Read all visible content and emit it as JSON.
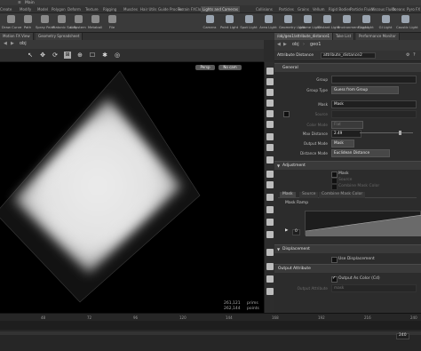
{
  "window": {
    "title": "Main"
  },
  "shelf_tabs": [
    {
      "label": "Create",
      "active": false
    },
    {
      "label": "Modify",
      "active": false
    },
    {
      "label": "Model",
      "active": false
    },
    {
      "label": "Polygon",
      "active": false
    },
    {
      "label": "Deform",
      "active": false
    },
    {
      "label": "Texture",
      "active": false
    },
    {
      "label": "Rigging",
      "active": false
    },
    {
      "label": "Muscles",
      "active": false
    },
    {
      "label": "Hair Utils",
      "active": false
    },
    {
      "label": "Guide Process",
      "active": false
    },
    {
      "label": "Terrain FX",
      "active": false
    },
    {
      "label": "Cloud FX",
      "active": false
    },
    {
      "label": "Volume",
      "active": false
    },
    {
      "label": "Lights and Cameras",
      "active": true
    },
    {
      "label": "Collisions",
      "active": false
    },
    {
      "label": "Particles",
      "active": false
    },
    {
      "label": "Grains",
      "active": false
    },
    {
      "label": "Vellum",
      "active": false
    },
    {
      "label": "Rigid Bodies",
      "active": false
    },
    {
      "label": "Particle Fluids",
      "active": false
    },
    {
      "label": "Viscous Fluids",
      "active": false
    },
    {
      "label": "Oceans",
      "active": false
    },
    {
      "label": "Pyro FX",
      "active": false
    }
  ],
  "shelf_tools_left": [
    "Draw Curve",
    "Path",
    "Spray Paint",
    "Platonic Solids",
    "L-System",
    "Metaball",
    "File"
  ],
  "shelf_tools_right": [
    "Camera",
    "Point Light",
    "Spot Light",
    "Area Light",
    "Geometry Light",
    "Volume Light",
    "Distant Light",
    "Environment Light",
    "Sky Light",
    "GI Light",
    "Caustic Light"
  ],
  "left_tabs": [
    "Motion FX View",
    "Geometry Spreadsheet"
  ],
  "right_tabs": [
    "/obj/geo1/attribute_distance1",
    "Take List",
    "Performance Monitor"
  ],
  "left_path": "obj",
  "right_path": {
    "context": "obj",
    "node": "geo1"
  },
  "viewport": {
    "persp_label": "Persp",
    "cam_label": "No cam",
    "stats": {
      "prims": "261,121",
      "prims_label": "prims",
      "points": "262,144",
      "points_label": "points"
    }
  },
  "node": {
    "type": "Attribute Distance",
    "name": "attribute_distance2"
  },
  "params": {
    "general_folder": "General",
    "group_label": "Group",
    "group_value": "",
    "group_type_label": "Group Type",
    "group_type_value": "Guess from Group",
    "mask_label": "Mask",
    "mask_value": "Mask",
    "source_label": "Source",
    "source_value": "",
    "color_mode_label": "Color Mode",
    "color_mode_value": "Flat",
    "max_distance_label": "Max Distance",
    "max_distance_value": "2.49",
    "output_mode_label": "Output Mode",
    "output_mode_value": "Mask",
    "distance_mode_label": "Distance Mode",
    "distance_mode_value": "Euclidean Distance",
    "adjustment_folder": "Adjustment",
    "adj_mask_label": "Mask",
    "adj_source_label": "Source",
    "adj_combine_label": "Combine Mask Color",
    "subtabs": [
      "Mask",
      "Source",
      "Combine Mask Color"
    ],
    "mask_ramp_label": "Mask Ramp",
    "ramp_value": "0",
    "displacement_folder": "Displacement",
    "use_displacement_label": "Use Displacement",
    "output_attribute_folder": "Output Attribute",
    "output_as_color_label": "Output As Color (Cd)",
    "output_attr_name_label": "Output Attribute",
    "output_attr_name_value": "mask"
  },
  "timeline": {
    "ticks": [
      "48",
      "72",
      "96",
      "120",
      "144",
      "168",
      "192",
      "216",
      "240"
    ],
    "end_frame": "240"
  }
}
